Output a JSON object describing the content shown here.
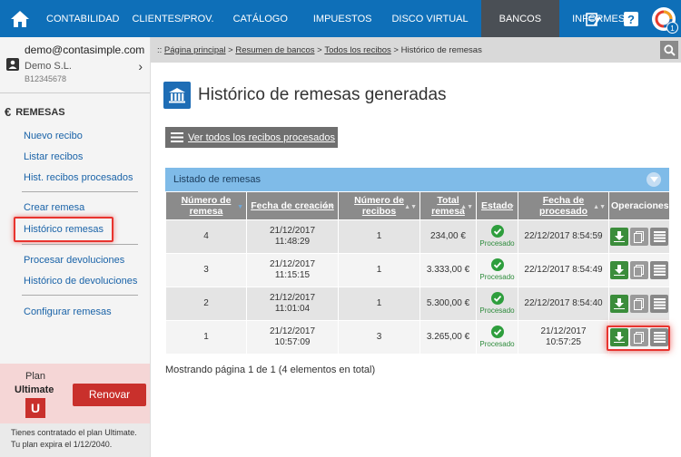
{
  "nav": {
    "items": [
      "CONTABILIDAD",
      "CLIENTES/PROV.",
      "CATÁLOGO",
      "IMPUESTOS",
      "DISCO VIRTUAL",
      "BANCOS",
      "INFORMES"
    ],
    "active": "BANCOS",
    "notification_count": "1",
    "brand_color": "#0e6fb8"
  },
  "account": {
    "email": "demo@contasimple.com",
    "company": "Demo S.L.",
    "tax_id": "B12345678"
  },
  "sidebar": {
    "section_title": "REMESAS",
    "group1": [
      "Nuevo recibo",
      "Listar recibos",
      "Hist. recibos procesados"
    ],
    "group2": [
      "Crear remesa",
      "Histórico remesas"
    ],
    "group3": [
      "Procesar devoluciones",
      "Histórico de devoluciones"
    ],
    "group4": [
      "Configurar remesas"
    ],
    "selected": "Histórico remesas"
  },
  "plan": {
    "label": "Plan",
    "name": "Ultimate",
    "badge": "U",
    "renew_label": "Renovar",
    "note_line1": "Tienes contratado el plan Ultimate.",
    "note_line2": "Tu plan expira el 1/12/2040."
  },
  "breadcrumb": {
    "prefix": "::",
    "links": [
      "Página principal",
      "Resumen de bancos",
      "Todos los recibos"
    ],
    "current": "Histórico de remesas",
    "separator": ">"
  },
  "page": {
    "title": "Histórico de remesas generadas",
    "all_receipts_button": "Ver todos los recibos procesados",
    "panel_title": "Listado de remesas",
    "pager": "Mostrando página 1 de 1 (4 elementos en total)"
  },
  "table": {
    "headers": [
      "Número de remesa",
      "Fecha de creación",
      "Número de recibos",
      "Total remesa",
      "Estado",
      "Fecha de procesado",
      "Operaciones"
    ],
    "status_label": "Procesado",
    "rows": [
      {
        "num": "4",
        "created_date": "21/12/2017",
        "created_time": "11:48:29",
        "receipts": "1",
        "total": "234,00 €",
        "processed": "22/12/2017 8:54:59"
      },
      {
        "num": "3",
        "created_date": "21/12/2017",
        "created_time": "11:15:15",
        "receipts": "1",
        "total": "3.333,00 €",
        "processed": "22/12/2017 8:54:49"
      },
      {
        "num": "2",
        "created_date": "21/12/2017",
        "created_time": "11:01:04",
        "receipts": "1",
        "total": "5.300,00 €",
        "processed": "22/12/2017 8:54:40"
      },
      {
        "num": "1",
        "created_date": "21/12/2017",
        "created_time": "10:57:09",
        "receipts": "3",
        "total": "3.265,00 €",
        "processed_date": "21/12/2017",
        "processed_time": "10:57:25"
      }
    ]
  }
}
